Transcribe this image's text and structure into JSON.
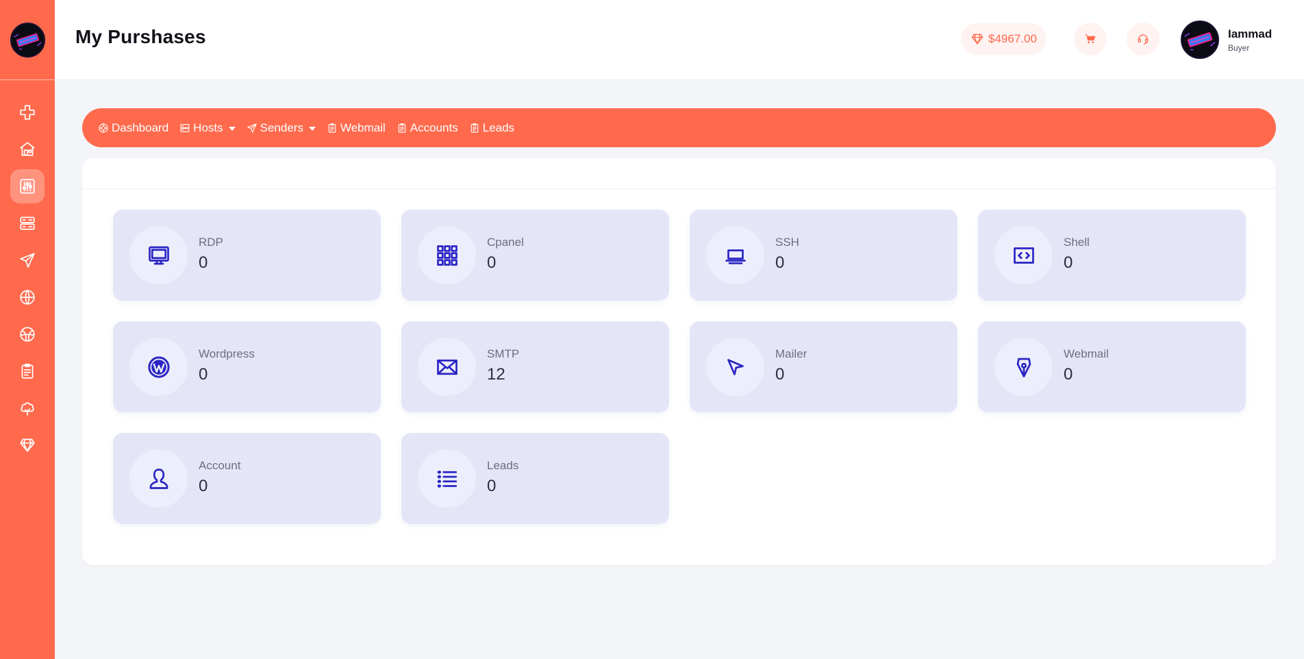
{
  "header": {
    "title": "My Purshases",
    "balance": "$4967.00",
    "user_name": "Iammad",
    "user_role": "Buyer"
  },
  "sidebar": {
    "items": [
      {
        "icon": "plus-icon"
      },
      {
        "icon": "store-icon"
      },
      {
        "icon": "sliders-icon",
        "active": true
      },
      {
        "icon": "server-icon"
      },
      {
        "icon": "send-icon"
      },
      {
        "icon": "globe-icon"
      },
      {
        "icon": "globe-alt-icon"
      },
      {
        "icon": "clipboard-icon"
      },
      {
        "icon": "tree-icon"
      },
      {
        "icon": "diamond-icon"
      }
    ]
  },
  "nav": {
    "items": [
      {
        "label": "Dashboard"
      },
      {
        "label": "Hosts",
        "dropdown": true
      },
      {
        "label": "Senders",
        "dropdown": true
      },
      {
        "label": "Webmail"
      },
      {
        "label": "Accounts"
      },
      {
        "label": "Leads"
      }
    ]
  },
  "stats": [
    {
      "label": "RDP",
      "value": "0",
      "icon": "monitor-icon"
    },
    {
      "label": "Cpanel",
      "value": "0",
      "icon": "grid-icon"
    },
    {
      "label": "SSH",
      "value": "0",
      "icon": "laptop-icon"
    },
    {
      "label": "Shell",
      "value": "0",
      "icon": "code-icon"
    },
    {
      "label": "Wordpress",
      "value": "0",
      "icon": "wordpress-icon"
    },
    {
      "label": "SMTP",
      "value": "12",
      "icon": "mail-icon"
    },
    {
      "label": "Mailer",
      "value": "0",
      "icon": "cursor-icon"
    },
    {
      "label": "Webmail",
      "value": "0",
      "icon": "pen-nib-icon"
    },
    {
      "label": "Account",
      "value": "0",
      "icon": "user-icon"
    },
    {
      "label": "Leads",
      "value": "0",
      "icon": "list-icon"
    }
  ],
  "colors": {
    "accent": "#ff6a4d",
    "card": "#e4e6f8",
    "icon": "#2a25c4"
  }
}
